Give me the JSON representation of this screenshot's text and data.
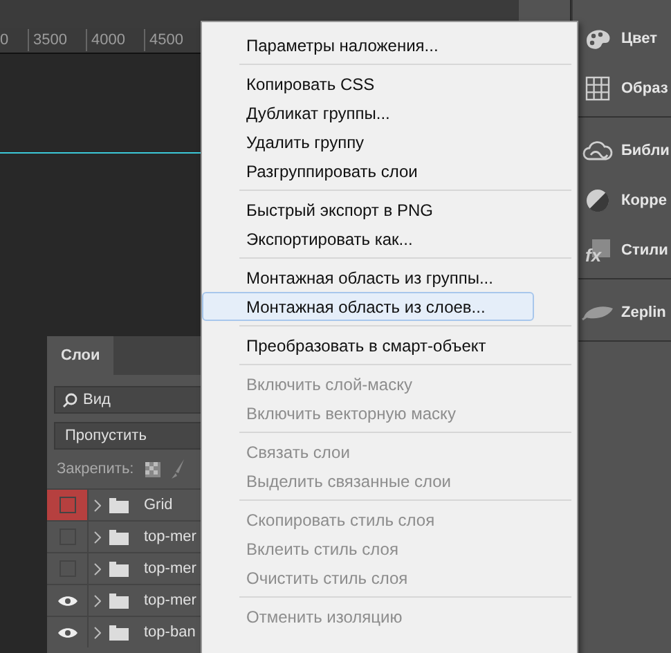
{
  "ruler": {
    "labels": [
      "0",
      "3500",
      "4000",
      "4500"
    ]
  },
  "right_panel": {
    "groups": [
      [
        {
          "label": "Цвет",
          "kind": "palette"
        },
        {
          "label": "Образ",
          "kind": "grid"
        }
      ],
      [
        {
          "label": "Библи",
          "kind": "cloud"
        },
        {
          "label": "Корре",
          "kind": "contrast"
        },
        {
          "label": "Стили",
          "kind": "fx"
        }
      ],
      [
        {
          "label": "Zeplin",
          "kind": "blimp"
        }
      ]
    ]
  },
  "layers_panel": {
    "tabs": [
      {
        "label": "Слои",
        "selected": true
      }
    ],
    "filter": {
      "value": "Вид"
    },
    "blend_mode": {
      "value": "Пропустить"
    },
    "lock_label": "Закрепить:",
    "layers": [
      {
        "name": "Grid",
        "visible": false,
        "color": "#b6403f"
      },
      {
        "name": "top-mer",
        "visible": false
      },
      {
        "name": "top-mer",
        "visible": false
      },
      {
        "name": "top-mer",
        "visible": true
      },
      {
        "name": "top-ban",
        "visible": true
      }
    ]
  },
  "context_menu": {
    "groups": [
      [
        {
          "label": "Параметры наложения...",
          "disabled": false,
          "selected": false
        }
      ],
      [
        {
          "label": "Копировать CSS",
          "disabled": false,
          "selected": false
        },
        {
          "label": "Дубликат группы...",
          "disabled": false,
          "selected": false
        },
        {
          "label": "Удалить группу",
          "disabled": false,
          "selected": false
        },
        {
          "label": "Разгруппировать слои",
          "disabled": false,
          "selected": false
        }
      ],
      [
        {
          "label": "Быстрый экспорт в PNG",
          "disabled": false,
          "selected": false
        },
        {
          "label": "Экспортировать как...",
          "disabled": false,
          "selected": false
        }
      ],
      [
        {
          "label": "Монтажная область из группы...",
          "disabled": false,
          "selected": false
        },
        {
          "label": "Монтажная область из слоев...",
          "disabled": false,
          "selected": true
        }
      ],
      [
        {
          "label": "Преобразовать в смарт-объект",
          "disabled": false,
          "selected": false
        }
      ],
      [
        {
          "label": "Включить слой-маску",
          "disabled": true,
          "selected": false
        },
        {
          "label": "Включить векторную маску",
          "disabled": true,
          "selected": false
        }
      ],
      [
        {
          "label": "Связать слои",
          "disabled": true,
          "selected": false
        },
        {
          "label": "Выделить связанные слои",
          "disabled": true,
          "selected": false
        }
      ],
      [
        {
          "label": "Скопировать стиль слоя",
          "disabled": true,
          "selected": false
        },
        {
          "label": "Вклеить стиль слоя",
          "disabled": true,
          "selected": false
        },
        {
          "label": "Очистить стиль слоя",
          "disabled": true,
          "selected": false
        }
      ],
      [
        {
          "label": "Отменить изоляцию",
          "disabled": true,
          "selected": false
        }
      ]
    ]
  }
}
